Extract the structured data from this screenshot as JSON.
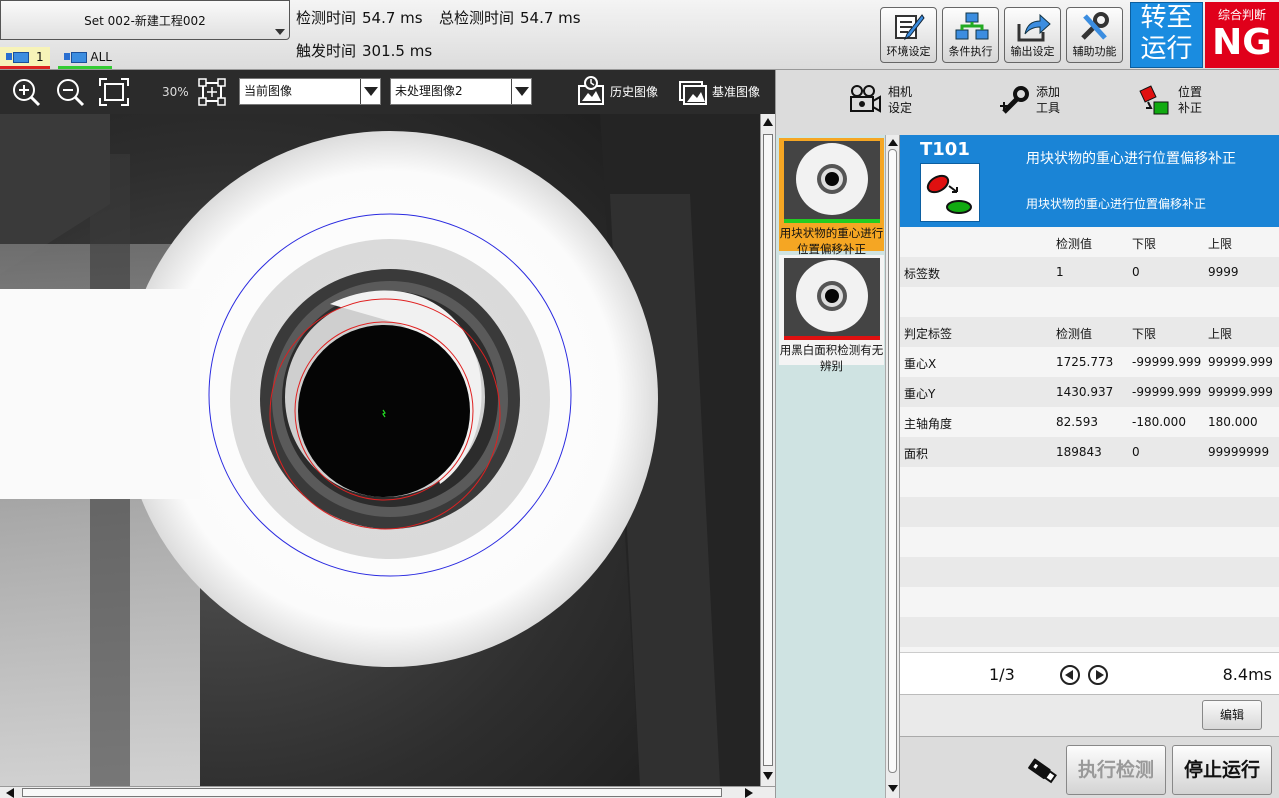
{
  "header": {
    "set_name": "Set 002-新建工程002",
    "camera_tabs": [
      {
        "label": "1"
      },
      {
        "label": "ALL"
      }
    ],
    "detect_time_label": "检测时间",
    "detect_time_value": "54.7 ms",
    "total_detect_time_label": "总检测时间",
    "total_detect_time_value": "54.7 ms",
    "trigger_time_label": "触发时间",
    "trigger_time_value": "301.5 ms",
    "tools": [
      {
        "label": "环境设定",
        "icon": "env-settings-icon"
      },
      {
        "label": "条件执行",
        "icon": "conditional-exec-icon"
      },
      {
        "label": "输出设定",
        "icon": "output-settings-icon"
      },
      {
        "label": "辅助功能",
        "icon": "aux-function-icon"
      }
    ],
    "run_button": {
      "line1": "转至",
      "line2": "运行",
      "color": "#1a8ce0"
    },
    "judgement": {
      "label": "综合判断",
      "value": "NG",
      "color": "#e0001a"
    }
  },
  "image_toolbar": {
    "zoom": "30%",
    "image_source": "当前图像",
    "image_processing": "未处理图像2",
    "history_label": "历史图像",
    "reference_label": "基准图像"
  },
  "right_toolbar": {
    "camera": {
      "line1": "相机",
      "line2": "设定"
    },
    "add_tool": {
      "line1": "添加",
      "line2": "工具"
    },
    "position": {
      "line1": "位置",
      "line2": "补正"
    }
  },
  "tool_list": [
    {
      "label": "用块状物的重心进行位置偏移补正",
      "status_color": "#22cc22"
    },
    {
      "label": "用黑白面积检测有无辨别",
      "status_color": "#e01010"
    }
  ],
  "detail": {
    "tool_id": "T101",
    "title": "用块状物的重心进行位置偏移补正",
    "description": "用块状物的重心进行位置偏移补正",
    "header1": {
      "c0": "",
      "c1": "检测值",
      "c2": "下限",
      "c3": "上限"
    },
    "label_count": {
      "c0": "标签数",
      "c1": "1",
      "c2": "0",
      "c3": "9999"
    },
    "header2": {
      "c0": "判定标签",
      "c1": "检测值",
      "c2": "下限",
      "c3": "上限"
    },
    "rows": [
      {
        "c0": "重心X",
        "c1": "1725.773",
        "c2": "-99999.999",
        "c3": "99999.999"
      },
      {
        "c0": "重心Y",
        "c1": "1430.937",
        "c2": "-99999.999",
        "c3": "99999.999"
      },
      {
        "c0": "主轴角度",
        "c1": "82.593",
        "c2": "-180.000",
        "c3": "180.000"
      },
      {
        "c0": "面积",
        "c1": "189843",
        "c2": "0",
        "c3": "99999999"
      }
    ],
    "page": "1/3",
    "exec_time": "8.4ms",
    "edit_label": "编辑",
    "execute_label": "执行检测",
    "stop_label": "停止运行"
  }
}
